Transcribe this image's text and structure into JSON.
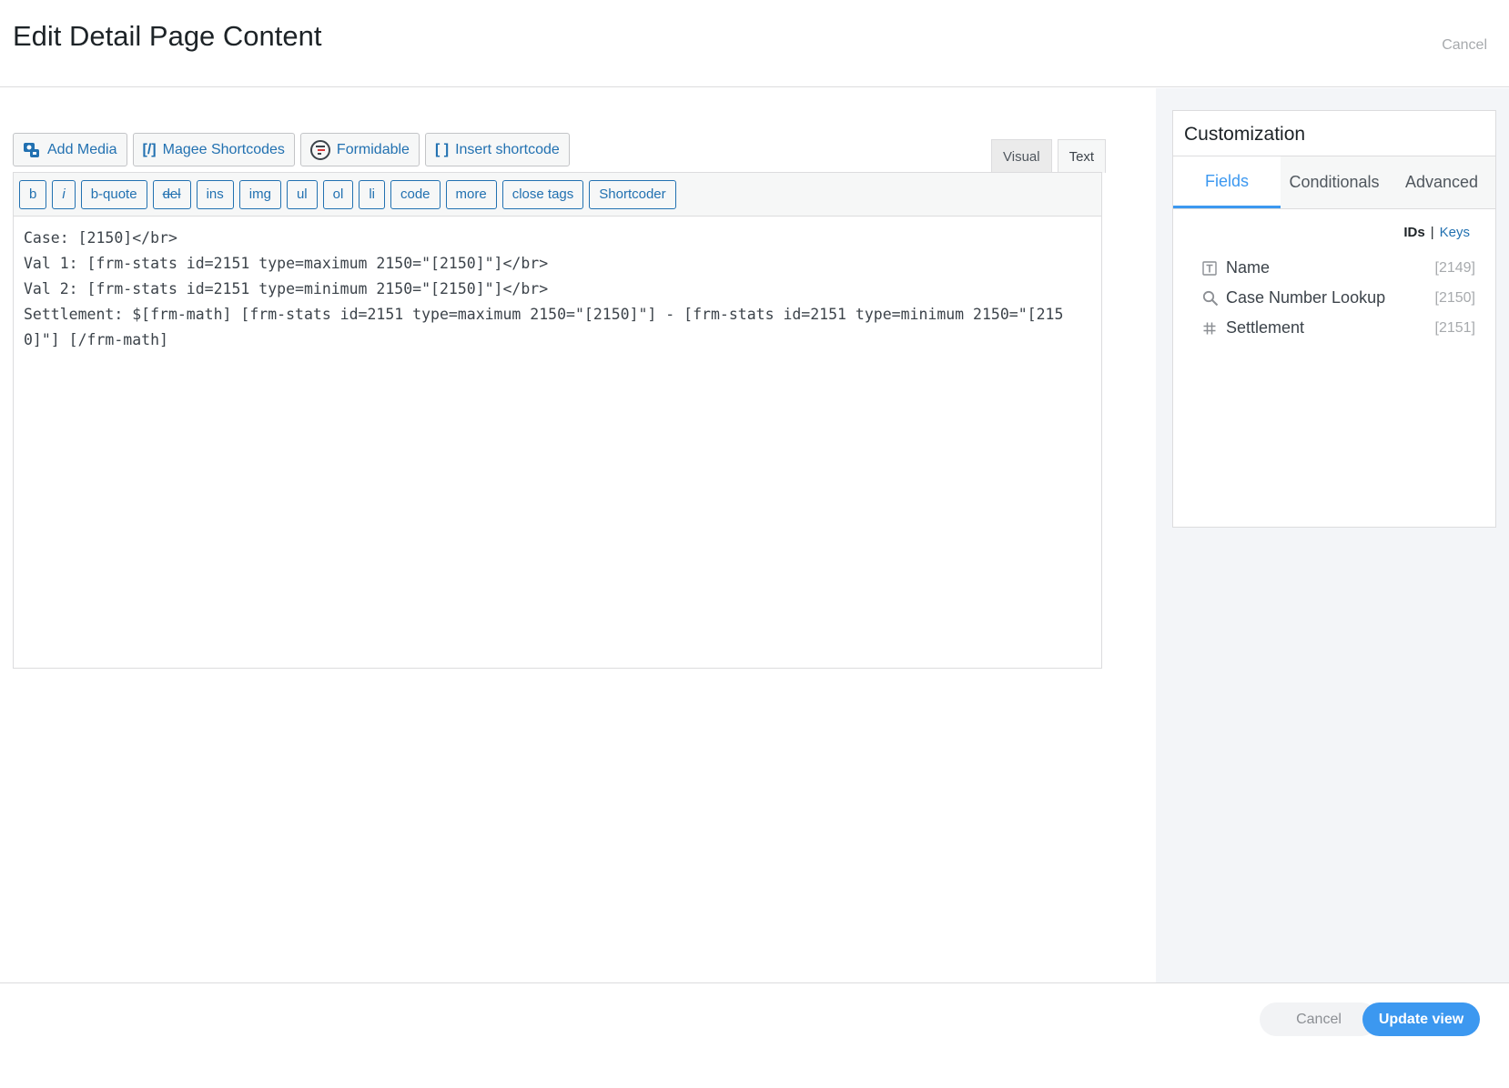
{
  "header": {
    "title": "Edit Detail Page Content",
    "cancel_label": "Cancel"
  },
  "media_buttons": [
    {
      "label": "Add Media",
      "icon": "add-media-icon"
    },
    {
      "label": "Magee Shortcodes",
      "icon": "shortcode-bracket-icon"
    },
    {
      "label": "Formidable",
      "icon": "formidable-icon"
    },
    {
      "label": "Insert shortcode",
      "icon": "bracket-icon"
    }
  ],
  "mode_tabs": {
    "visual": "Visual",
    "text": "Text",
    "active": "Text"
  },
  "quicktags": [
    "b",
    "i",
    "b-quote",
    "del",
    "ins",
    "img",
    "ul",
    "ol",
    "li",
    "code",
    "more",
    "close tags",
    "Shortcoder"
  ],
  "editor": {
    "content": "Case: [2150]</br>\nVal 1: [frm-stats id=2151 type=maximum 2150=\"[2150]\"]</br>\nVal 2: [frm-stats id=2151 type=minimum 2150=\"[2150]\"]</br>\nSettlement: $[frm-math] [frm-stats id=2151 type=maximum 2150=\"[2150]\"] - [frm-stats id=2151 type=minimum 2150=\"[2150]\"] [/frm-math]"
  },
  "customization": {
    "title": "Customization",
    "tabs": [
      "Fields",
      "Conditionals",
      "Advanced"
    ],
    "active_tab": "Fields",
    "toggle": {
      "ids": "IDs",
      "separator": "|",
      "keys": "Keys"
    },
    "fields": [
      {
        "name": "Name",
        "id": "[2149]",
        "icon": "text-field-icon"
      },
      {
        "name": "Case Number Lookup",
        "id": "[2150]",
        "icon": "search-icon"
      },
      {
        "name": "Settlement",
        "id": "[2151]",
        "icon": "hash-icon"
      }
    ]
  },
  "footer": {
    "cancel_label": "Cancel",
    "update_label": "Update view"
  },
  "colors": {
    "accent": "#3c98f0",
    "link": "#2271b1",
    "sidebar_bg": "#f3f5f8"
  }
}
